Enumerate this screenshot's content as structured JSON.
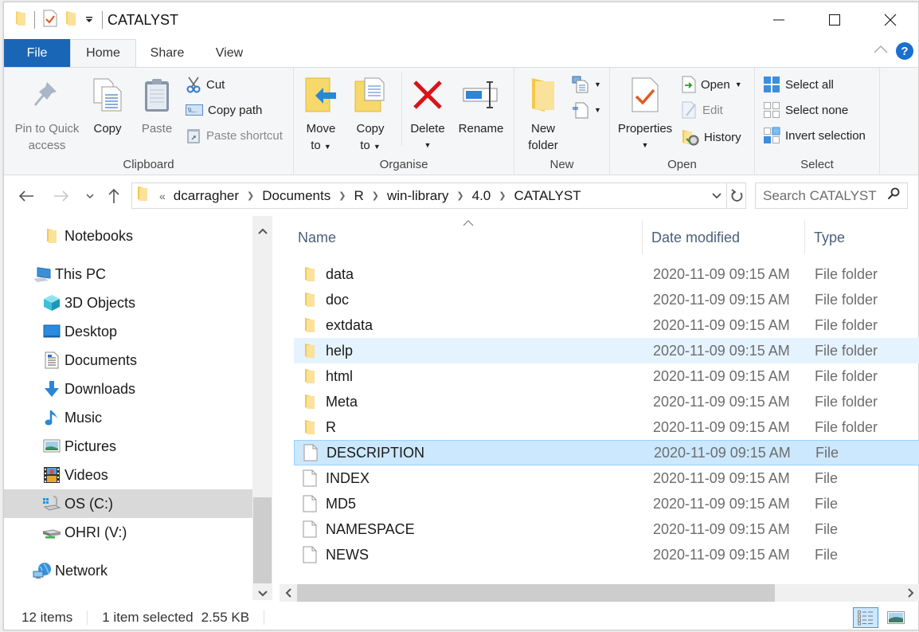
{
  "window": {
    "title": "CATALYST",
    "controls": {
      "minimize": "minimize",
      "maximize": "maximize",
      "close": "close"
    }
  },
  "quick_access": {
    "icons": [
      "folder-icon",
      "properties-icon",
      "new-folder-icon",
      "customize-dropdown-icon"
    ]
  },
  "tabs": [
    {
      "label": "File"
    },
    {
      "label": "Home"
    },
    {
      "label": "Share"
    },
    {
      "label": "View"
    }
  ],
  "ribbon": {
    "clipboard": {
      "label": "Clipboard",
      "pin_line1": "Pin to Quick",
      "pin_line2": "access",
      "copy": "Copy",
      "paste": "Paste",
      "cut": "Cut",
      "copy_path": "Copy path",
      "paste_shortcut": "Paste shortcut"
    },
    "organise": {
      "label": "Organise",
      "move_line1": "Move",
      "move_line2": "to",
      "copy_line1": "Copy",
      "copy_line2": "to",
      "delete": "Delete",
      "rename": "Rename"
    },
    "new": {
      "label": "New",
      "new_folder_line1": "New",
      "new_folder_line2": "folder"
    },
    "open": {
      "label": "Open",
      "properties": "Properties",
      "open": "Open",
      "edit": "Edit",
      "history": "History"
    },
    "select": {
      "label": "Select",
      "select_all": "Select all",
      "select_none": "Select none",
      "invert": "Invert selection"
    }
  },
  "address": {
    "overflow": "«",
    "crumbs": [
      "dcarragher",
      "Documents",
      "R",
      "win-library",
      "4.0",
      "CATALYST"
    ],
    "search_placeholder": "Search CATALYST"
  },
  "nav_pane": {
    "items": [
      {
        "label": "Notebooks",
        "icon": "folder-icon"
      },
      {
        "label": "This PC",
        "icon": "computer-icon"
      },
      {
        "label": "3D Objects",
        "icon": "3d-objects-icon"
      },
      {
        "label": "Desktop",
        "icon": "desktop-icon"
      },
      {
        "label": "Documents",
        "icon": "documents-icon"
      },
      {
        "label": "Downloads",
        "icon": "downloads-icon"
      },
      {
        "label": "Music",
        "icon": "music-icon"
      },
      {
        "label": "Pictures",
        "icon": "pictures-icon"
      },
      {
        "label": "Videos",
        "icon": "videos-icon"
      },
      {
        "label": "OS (C:)",
        "icon": "drive-c-icon",
        "selected": true
      },
      {
        "label": "OHRI (V:)",
        "icon": "network-drive-icon"
      },
      {
        "label": "Network",
        "icon": "network-icon"
      }
    ]
  },
  "columns": {
    "name": "Name",
    "date": "Date modified",
    "type": "Type"
  },
  "files": [
    {
      "name": "data",
      "date": "2020-11-09 09:15 AM",
      "type": "File folder",
      "kind": "folder"
    },
    {
      "name": "doc",
      "date": "2020-11-09 09:15 AM",
      "type": "File folder",
      "kind": "folder"
    },
    {
      "name": "extdata",
      "date": "2020-11-09 09:15 AM",
      "type": "File folder",
      "kind": "folder"
    },
    {
      "name": "help",
      "date": "2020-11-09 09:15 AM",
      "type": "File folder",
      "kind": "folder",
      "state": "hover"
    },
    {
      "name": "html",
      "date": "2020-11-09 09:15 AM",
      "type": "File folder",
      "kind": "folder"
    },
    {
      "name": "Meta",
      "date": "2020-11-09 09:15 AM",
      "type": "File folder",
      "kind": "folder"
    },
    {
      "name": "R",
      "date": "2020-11-09 09:15 AM",
      "type": "File folder",
      "kind": "folder"
    },
    {
      "name": "DESCRIPTION",
      "date": "2020-11-09 09:15 AM",
      "type": "File",
      "kind": "file",
      "state": "selected"
    },
    {
      "name": "INDEX",
      "date": "2020-11-09 09:15 AM",
      "type": "File",
      "kind": "file"
    },
    {
      "name": "MD5",
      "date": "2020-11-09 09:15 AM",
      "type": "File",
      "kind": "file"
    },
    {
      "name": "NAMESPACE",
      "date": "2020-11-09 09:15 AM",
      "type": "File",
      "kind": "file"
    },
    {
      "name": "NEWS",
      "date": "2020-11-09 09:15 AM",
      "type": "File",
      "kind": "file"
    }
  ],
  "status": {
    "item_count": "12 items",
    "selection": "1 item selected",
    "size": "2.55 KB"
  },
  "colors": {
    "file_tab": "#1a66b6",
    "hover_row": "#e5f3ff",
    "selected_row": "#cce8ff",
    "selected_border": "#99d1ff",
    "folder": "#f2c94c",
    "delete_red": "#d8141a"
  }
}
